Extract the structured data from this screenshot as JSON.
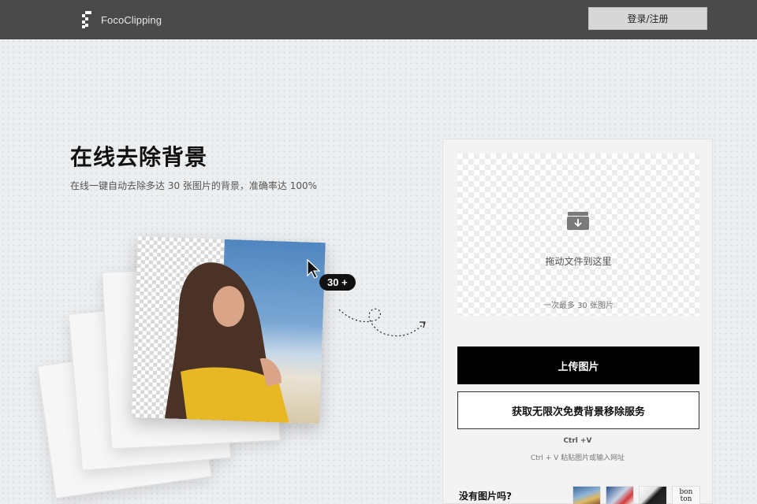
{
  "header": {
    "brand": "FocoClipping",
    "login_label": "登录/注册"
  },
  "hero": {
    "title": "在线去除背景",
    "subtitle": "在线一键自动去除多达 30 张图片的背景，准确率达 100%",
    "badge": "30 +"
  },
  "upload": {
    "drop_text": "拖动文件到这里",
    "drop_limit": "一次最多 30 张图片",
    "upload_label": "上传图片",
    "unlimited_label": "获取无限次免费背景移除服务",
    "shortcut": "Ctrl +V",
    "paste_hint": "Ctrl + V 粘贴图片或输入网址",
    "no_image_label": "没有图片吗?",
    "sample_text": "bon ton"
  },
  "icons": [
    "logo-icon",
    "cursor-icon",
    "download-tray-icon",
    "dotted-arrow-icon"
  ],
  "colors": {
    "header_bg": "#4a4a4a",
    "primary_button": "#000000",
    "page_bg": "#eceef0"
  }
}
